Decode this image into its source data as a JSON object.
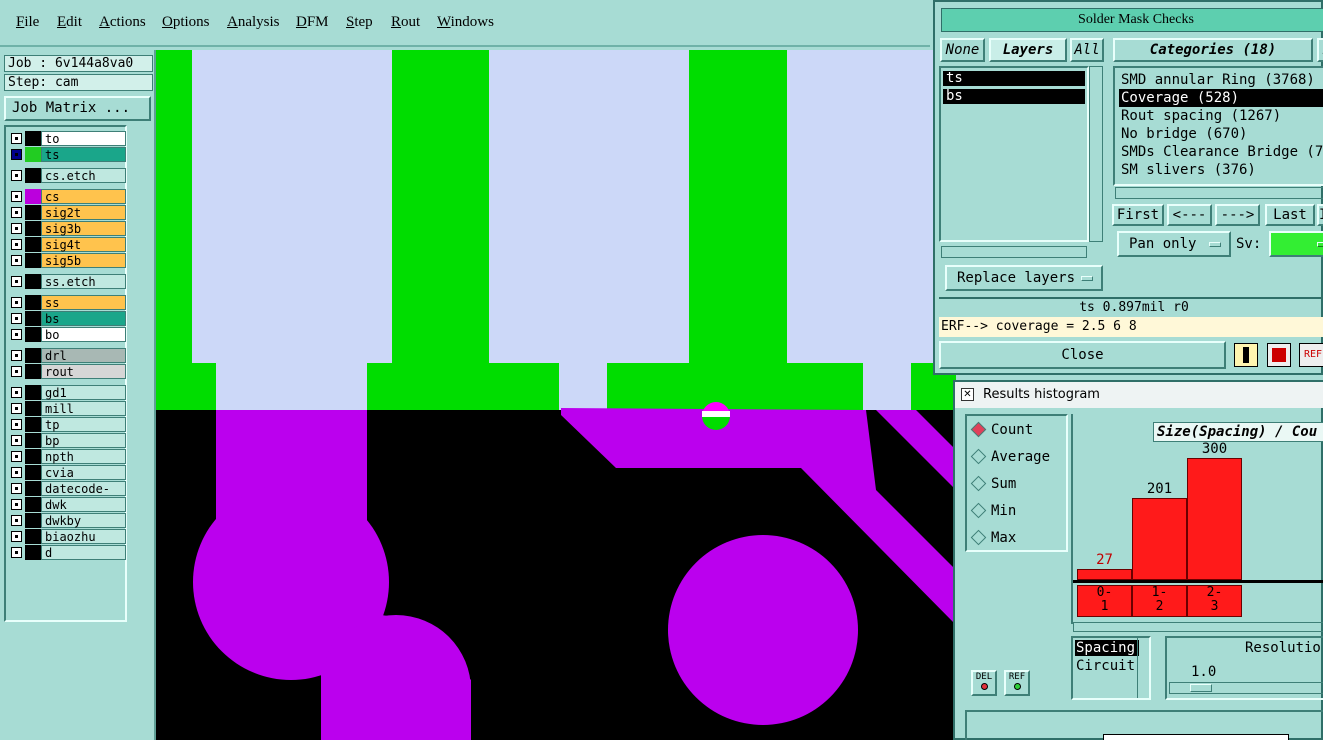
{
  "menu": [
    "File",
    "Edit",
    "Actions",
    "Options",
    "Analysis",
    "DFM",
    "Step",
    "Rout",
    "Windows"
  ],
  "job": {
    "job_line": "Job : 6v144a8va0",
    "step_line": "Step: cam",
    "matrix_button": "Job Matrix ..."
  },
  "layers": [
    {
      "name": "to",
      "color": "#ffffff",
      "swatch": "#000000",
      "selected": false
    },
    {
      "name": "ts",
      "color": "#1aa68a",
      "swatch": "#22cc22",
      "selected": true
    },
    {
      "name": "cs.etch",
      "color": "#bfe8e0",
      "swatch": "#000000",
      "selected": false
    },
    {
      "name": "cs",
      "color": "#ffc34d",
      "swatch": "#bb00dd",
      "selected": false
    },
    {
      "name": "sig2t",
      "color": "#ffc34d",
      "swatch": "#000000",
      "selected": false
    },
    {
      "name": "sig3b",
      "color": "#ffc34d",
      "swatch": "#000000",
      "selected": false
    },
    {
      "name": "sig4t",
      "color": "#ffc34d",
      "swatch": "#000000",
      "selected": false
    },
    {
      "name": "sig5b",
      "color": "#ffc34d",
      "swatch": "#000000",
      "selected": false
    },
    {
      "name": "ss.etch",
      "color": "#bfe8e0",
      "swatch": "#000000",
      "selected": false
    },
    {
      "name": "ss",
      "color": "#ffc34d",
      "swatch": "#000000",
      "selected": false
    },
    {
      "name": "bs",
      "color": "#1aa68a",
      "swatch": "#000000",
      "selected": false
    },
    {
      "name": "bo",
      "color": "#ffffff",
      "swatch": "#000000",
      "selected": false
    },
    {
      "name": "drl",
      "color": "#a8b8b4",
      "swatch": "#000000",
      "selected": false
    },
    {
      "name": "rout",
      "color": "#d6d6d6",
      "swatch": "#000000",
      "selected": false
    },
    {
      "name": "gd1",
      "color": "#bfe8e0",
      "swatch": "#000000",
      "selected": false
    },
    {
      "name": "mill",
      "color": "#bfe8e0",
      "swatch": "#000000",
      "selected": false
    },
    {
      "name": "tp",
      "color": "#bfe8e0",
      "swatch": "#000000",
      "selected": false
    },
    {
      "name": "bp",
      "color": "#bfe8e0",
      "swatch": "#000000",
      "selected": false
    },
    {
      "name": "npth",
      "color": "#bfe8e0",
      "swatch": "#000000",
      "selected": false
    },
    {
      "name": "cvia",
      "color": "#bfe8e0",
      "swatch": "#000000",
      "selected": false
    },
    {
      "name": "datecode-pbc",
      "color": "#bfe8e0",
      "swatch": "#000000",
      "selected": false
    },
    {
      "name": "dwk",
      "color": "#bfe8e0",
      "swatch": "#000000",
      "selected": false
    },
    {
      "name": "dwkby",
      "color": "#bfe8e0",
      "swatch": "#000000",
      "selected": false
    },
    {
      "name": "biaozhu",
      "color": "#bfe8e0",
      "swatch": "#000000",
      "selected": false
    },
    {
      "name": "d",
      "color": "#bfe8e0",
      "swatch": "#000000",
      "selected": false
    }
  ],
  "canvas_colors": {
    "background": "#000000",
    "mask_green": "#00dd00",
    "pad_fill": "#ccd8f8",
    "copper_purple": "#bb00ee"
  },
  "smc": {
    "title": "Solder Mask Checks",
    "tab_none": "None",
    "tab_layers": "Layers",
    "tab_all": "All",
    "tab_n": "N",
    "categories_label": "Categories (18)",
    "layers": [
      "ts",
      "bs"
    ],
    "categories": [
      "SMD annular Ring (3768)",
      "Coverage (528)",
      "Rout spacing (1267)",
      "No bridge (670)",
      "SMDs Clearance Bridge (7",
      "SM slivers (376)"
    ],
    "selected_category": 1,
    "nav": [
      "First",
      "<---",
      "--->",
      "Last",
      "In"
    ],
    "pan_option": "Pan only",
    "sv_label": "Sv:",
    "replace_layers": "Replace layers",
    "status": "ts 0.897mil  r0",
    "erf_line": "ERF--> coverage = 2.5 6 8",
    "close": "Close",
    "ref_label": "REF"
  },
  "histogram": {
    "window_title": "Results histogram",
    "radio_options": [
      "Count",
      "Average",
      "Sum",
      "Min",
      "Max"
    ],
    "selected_radio": 0,
    "header": "Size(Spacing) / Cou",
    "spacing_label": "Spacing",
    "circuit_label": "Circuit",
    "resolution_label": "Resolutio",
    "resolution_value": "1.0",
    "del_label": "DEL",
    "ref_label": "REF"
  },
  "chart_data": {
    "type": "bar",
    "categories": [
      "0-\n1",
      "1-\n2",
      "2-\n3"
    ],
    "values": [
      27,
      201,
      300
    ],
    "ylim": [
      0,
      300
    ],
    "title": "Size(Spacing) / Cou"
  }
}
